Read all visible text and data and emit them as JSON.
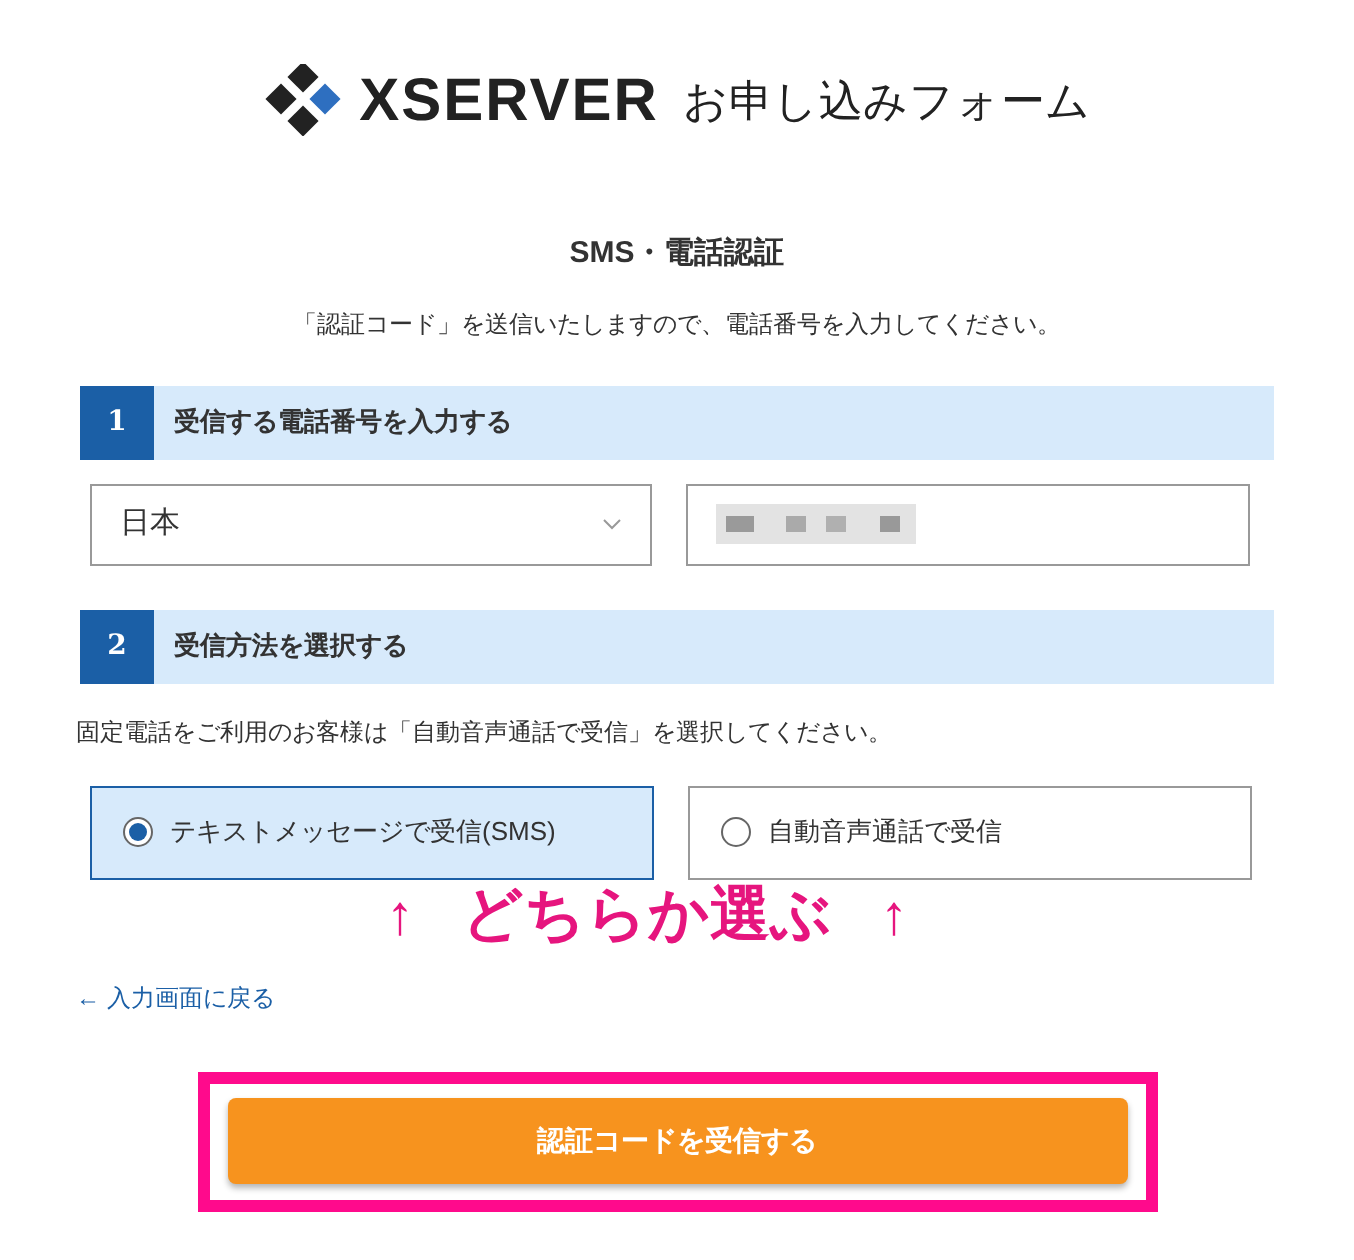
{
  "logo": {
    "brand": "XSERVER",
    "subtitle": "お申し込みフォーム"
  },
  "title": "SMS・電話認証",
  "description": "「認証コード」を送信いたしますので、電話番号を入力してください。",
  "step1": {
    "number": "1",
    "heading": "受信する電話番号を入力する",
    "country_select": {
      "value": "日本"
    }
  },
  "step2": {
    "number": "2",
    "heading": "受信方法を選択する",
    "notice": "固定電話をご利用のお客様は「自動音声通話で受信」を選択してください。",
    "options": [
      {
        "label": "テキストメッセージで受信(SMS)",
        "selected": true
      },
      {
        "label": "自動音声通話で受信",
        "selected": false
      }
    ]
  },
  "annotation": {
    "left_arrow": "↑",
    "text": "どちらか選ぶ",
    "right_arrow": "↑"
  },
  "back_link": "← 入力画面に戻る",
  "submit_button": {
    "label": "認証コードを受信する",
    "highlighted": true
  }
}
